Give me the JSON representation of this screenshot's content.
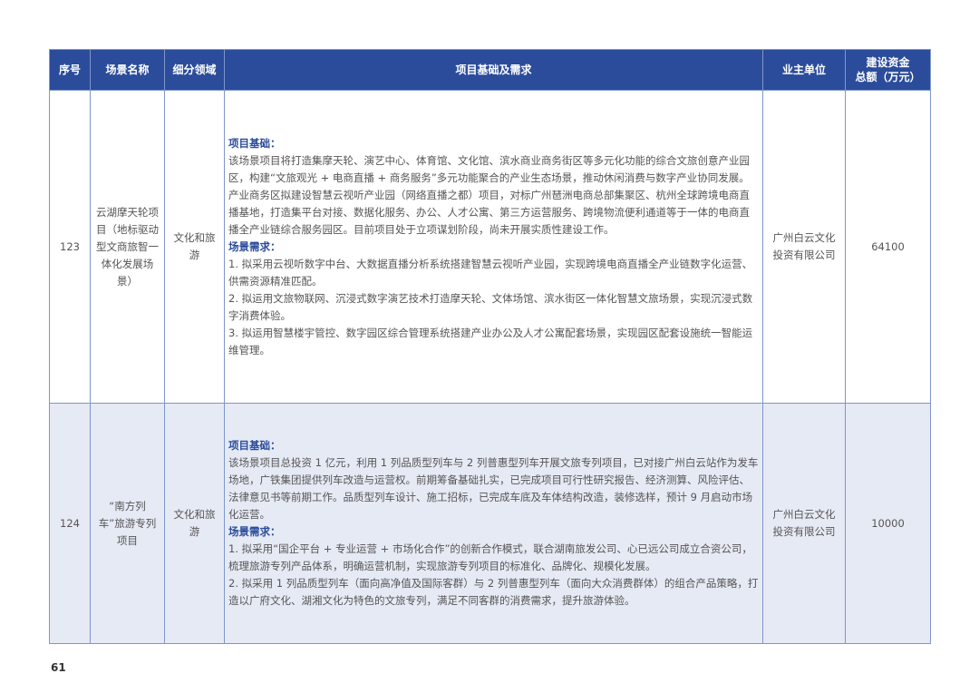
{
  "headers": {
    "no": "序号",
    "scene": "场景名称",
    "field": "细分领域",
    "basis": "项目基础及需求",
    "owner": "业主单位",
    "fund_line1": "建设资金",
    "fund_line2": "总额（万元）"
  },
  "rows": [
    {
      "no": "123",
      "scene": "云湖摩天轮项目（地标驱动型文商旅智一体化发展场景）",
      "field": "文化和旅游",
      "basis_heading": "项目基础：",
      "basis_text": "该场景项目将打造集摩天轮、演艺中心、体育馆、文化馆、滨水商业商务街区等多元化功能的综合文旅创意产业园区，构建“文旅观光 + 电商直播 + 商务服务”多元功能聚合的产业生态场景，推动休闲消费与数字产业协同发展。产业商务区拟建设智慧云视听产业园（网络直播之都）项目，对标广州琶洲电商总部集聚区、杭州全球跨境电商直播基地，打造集平台对接、数据化服务、办公、人才公寓、第三方运营服务、跨境物流便利通道等于一体的电商直播全产业链综合服务园区。目前项目处于立项谋划阶段，尚未开展实质性建设工作。",
      "needs_heading": "场景需求：",
      "needs": [
        "1. 拟采用云视听数字中台、大数据直播分析系统搭建智慧云视听产业园，实现跨境电商直播全产业链数字化运营、供需资源精准匹配。",
        "2. 拟运用文旅物联网、沉浸式数字演艺技术打造摩天轮、文体场馆、滨水街区一体化智慧文旅场景，实现沉浸式数字消费体验。",
        "3. 拟运用智慧楼宇管控、数字园区综合管理系统搭建产业办公及人才公寓配套场景，实现园区配套设施统一智能运维管理。"
      ],
      "owner": "广州白云文化投资有限公司",
      "fund": "64100"
    },
    {
      "no": "124",
      "scene": "“南方列车”旅游专列项目",
      "field": "文化和旅游",
      "basis_heading": "项目基础：",
      "basis_text": "该场景项目总投资 1 亿元，利用 1 列品质型列车与 2 列普惠型列车开展文旅专列项目，已对接广州白云站作为发车场地，广铁集团提供列车改造与运营权。前期筹备基础扎实，已完成项目可行性研究报告、经济测算、风险评估、法律意见书等前期工作。品质型列车设计、施工招标，已完成车底及车体结构改造，装修选样，预计 9 月启动市场化运营。",
      "needs_heading": "场景需求：",
      "needs": [
        "1. 拟采用“国企平台 + 专业运营 + 市场化合作”的创新合作模式，联合湖南旅发公司、心已远公司成立合资公司，梳理旅游专列产品体系，明确运营机制，实现旅游专列项目的标准化、品牌化、规模化发展。",
        "2. 拟采用 1 列品质型列车（面向高净值及国际客群）与 2 列普惠型列车（面向大众消费群体）的组合产品策略，打造以广府文化、湖湘文化为特色的文旅专列，满足不同客群的消费需求，提升旅游体验。"
      ],
      "owner": "广州白云文化投资有限公司",
      "fund": "10000"
    }
  ],
  "page_number": "61"
}
